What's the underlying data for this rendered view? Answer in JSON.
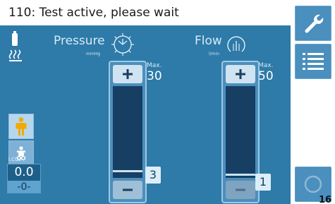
{
  "status": {
    "message": "110: Test active, please wait"
  },
  "left_panel": {
    "co2_label": "i.CO₂",
    "co2_value": "0.0",
    "lower_value": "-0-"
  },
  "pressure": {
    "title": "Pressure",
    "unit": "mmHg",
    "max_label": "Max.",
    "max_value": "30",
    "set_value": "3",
    "level_fraction": 0.06
  },
  "flow": {
    "title": "Flow",
    "unit": "l/min",
    "max_label": "Max.",
    "max_value": "50",
    "set_value": "1",
    "level_fraction": 0.02
  },
  "icons": {
    "wrench": "wrench-icon",
    "menu": "list-menu-icon",
    "power": "power-icon",
    "bottle": "gas-bottle-icon",
    "heater": "heater-icon",
    "adult": "adult-patient-icon",
    "child": "child-patient-icon"
  },
  "corner": {
    "label": "16"
  },
  "colors": {
    "screen": "#2e7aa8",
    "track": "#163f63",
    "accent": "#f2a900"
  }
}
